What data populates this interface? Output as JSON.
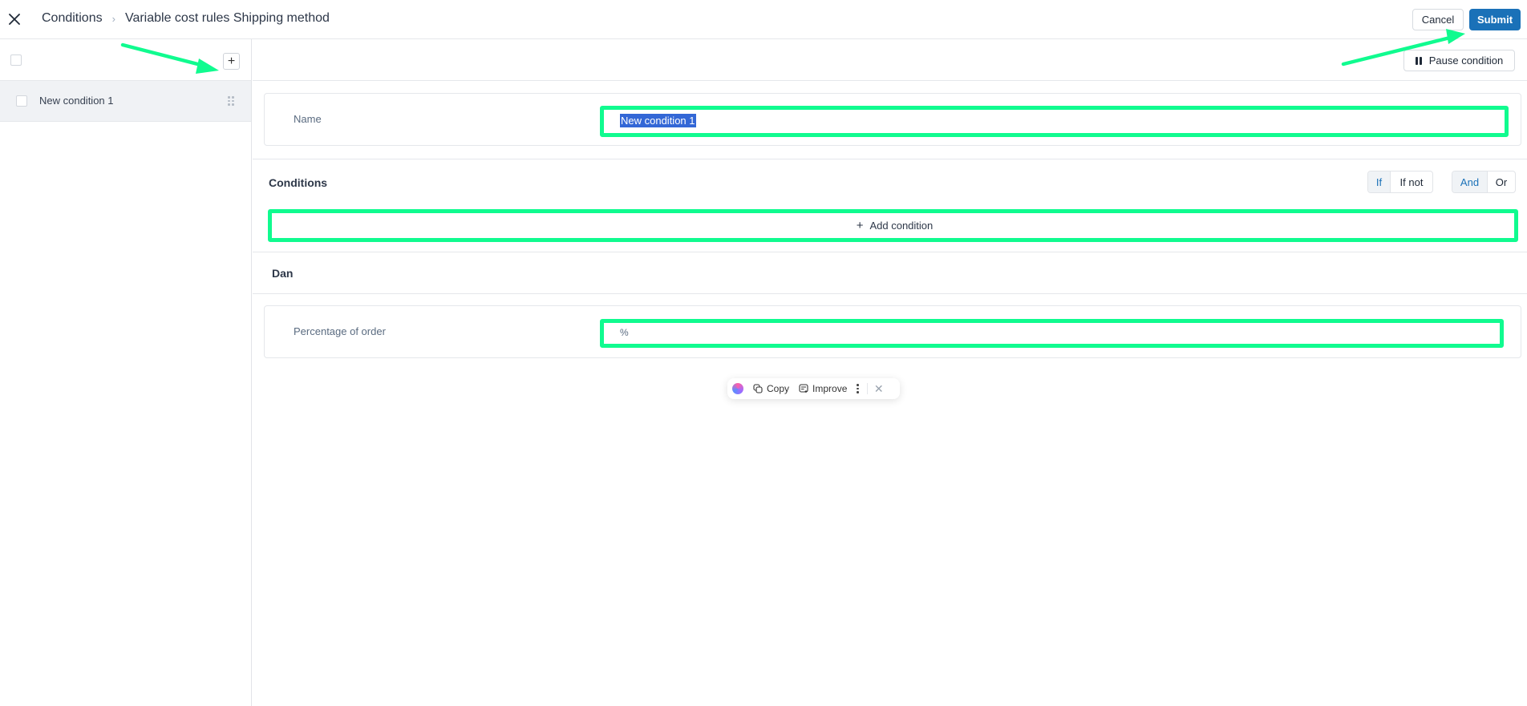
{
  "header": {
    "close_icon": "close-icon",
    "breadcrumb": [
      "Conditions",
      "Variable cost rules Shipping method"
    ],
    "cancel_label": "Cancel",
    "submit_label": "Submit"
  },
  "sidebar": {
    "add_icon": "plus-icon",
    "items": [
      {
        "label": "New condition 1",
        "selected": true
      }
    ]
  },
  "main": {
    "pause_label": "Pause condition",
    "name_field": {
      "label": "Name",
      "value": "New condition 1"
    },
    "conditions": {
      "title": "Conditions",
      "mode_options": [
        "If",
        "If not"
      ],
      "mode_selected": "If",
      "logic_options": [
        "And",
        "Or"
      ],
      "logic_selected": "And",
      "add_condition_label": "Add condition"
    },
    "result_section": {
      "title": "Dan",
      "field_label": "Percentage of order",
      "field_prefix": "%",
      "field_value": ""
    }
  },
  "floating_toolbar": {
    "copy_label": "Copy",
    "improve_label": "Improve"
  },
  "colors": {
    "accent": "#1a71b8",
    "annotation": "#10fb8f",
    "selection": "#3367d6"
  }
}
